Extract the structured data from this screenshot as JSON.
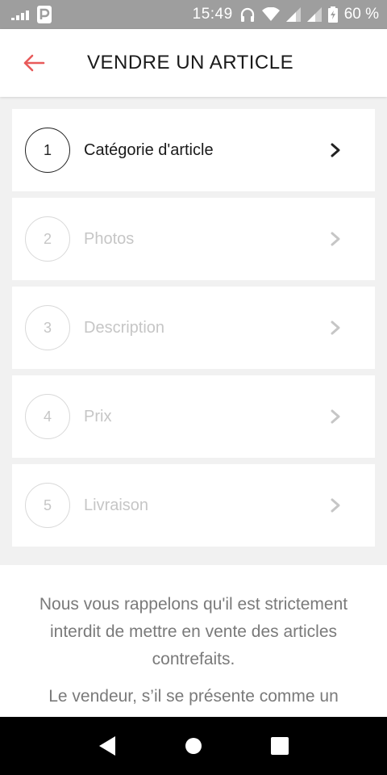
{
  "status_bar": {
    "time": "15:49",
    "battery": "60 %",
    "icons": [
      "deezer-icon",
      "parking-icon",
      "headset-icon",
      "wifi-icon",
      "signal-icon",
      "signal-icon",
      "battery-icon"
    ]
  },
  "header": {
    "title": "VENDRE UN ARTICLE",
    "back_icon": "arrow-left-icon",
    "accent_color": "#e85a5a"
  },
  "steps": [
    {
      "number": "1",
      "label": "Catégorie d'article",
      "active": true
    },
    {
      "number": "2",
      "label": "Photos",
      "active": false
    },
    {
      "number": "3",
      "label": "Description",
      "active": false
    },
    {
      "number": "4",
      "label": "Prix",
      "active": false
    },
    {
      "number": "5",
      "label": "Livraison",
      "active": false
    }
  ],
  "notice": {
    "paragraph1": "Nous vous rappelons qu'il est strictement interdit de mettre en vente des articles contrefaits.",
    "paragraph2": "Le vendeur, s’il se présente comme un"
  },
  "nav_bar": {
    "icons": [
      "back-triangle-icon",
      "home-circle-icon",
      "recents-square-icon"
    ]
  }
}
